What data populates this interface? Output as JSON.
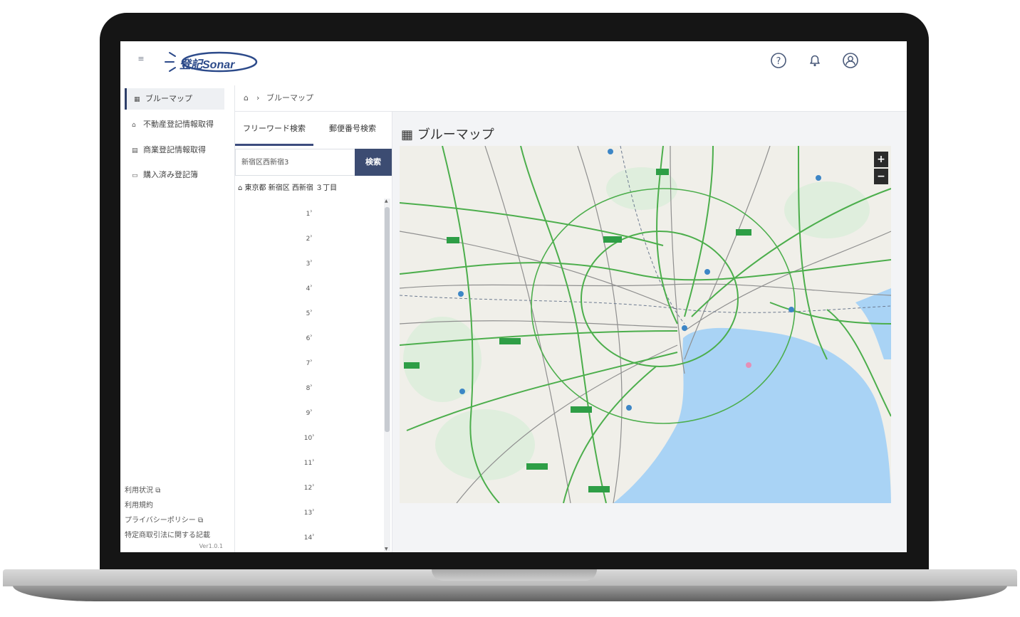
{
  "app": {
    "name": "登記Sonar"
  },
  "sidebar": {
    "items": [
      {
        "label": "ブルーマップ",
        "icon": "map-icon",
        "active": true
      },
      {
        "label": "不動産登記情報取得",
        "icon": "home-icon",
        "active": false
      },
      {
        "label": "商業登記情報取得",
        "icon": "building-icon",
        "active": false
      },
      {
        "label": "購入済み登記簿",
        "icon": "document-icon",
        "active": false
      }
    ],
    "footer": [
      {
        "label": "利用状況",
        "external": true
      },
      {
        "label": "利用規約",
        "external": false
      },
      {
        "label": "プライバシーポリシー",
        "external": true
      },
      {
        "label": "特定商取引法に関する記載",
        "external": false
      }
    ],
    "version": "Ver1.0.1"
  },
  "breadcrumb": {
    "current": "ブルーマップ"
  },
  "search": {
    "tabs": [
      {
        "label": "フリーワード検索",
        "active": true
      },
      {
        "label": "郵便番号検索",
        "active": false
      }
    ],
    "input_value": "新宿区西新宿3",
    "button_label": "検索",
    "result_address": "東京都 新宿区 西新宿 ３丁目",
    "lot_numbers": [
      "1",
      "2",
      "3",
      "4",
      "5",
      "6",
      "7",
      "8",
      "9",
      "10",
      "11",
      "12",
      "13",
      "14"
    ]
  },
  "map": {
    "title": "ブルーマップ",
    "zoom_in": "+",
    "zoom_out": "−",
    "colors": {
      "water": "#a9d3f5",
      "land": "#f0efe9",
      "road": "#5cb85c",
      "rail": "#8a8a8a"
    }
  }
}
